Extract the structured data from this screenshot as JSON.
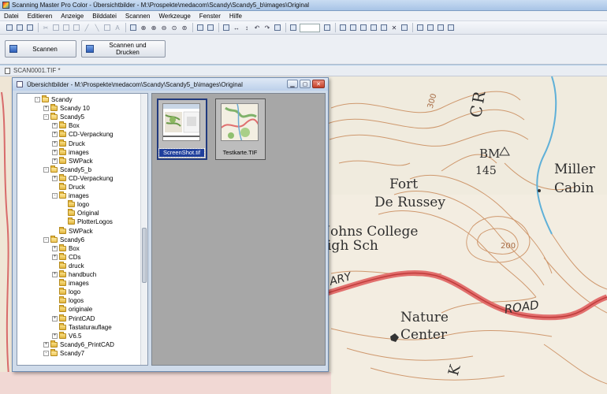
{
  "window": {
    "title": "Scanning Master Pro Color - Übersichtbilder - M:\\Prospekte\\medacom\\Scandy\\Scandy5_b\\images\\Original"
  },
  "menu": [
    "Datei",
    "Editieren",
    "Anzeige",
    "Bilddatei",
    "Scannen",
    "Werkzeuge",
    "Fenster",
    "Hilfe"
  ],
  "buttons": {
    "scan": "Scannen",
    "scan_print": "Scannen und Drucken"
  },
  "document_tab": {
    "label": "SCAN0001.TIF *"
  },
  "child_window": {
    "title": "Übersichtbilder - M:\\Prospekte\\medacom\\Scandy\\Scandy5_b\\images\\Original",
    "buttons": {
      "minimize": "▁",
      "maximize": "▢",
      "close": "✕"
    }
  },
  "tree": [
    {
      "label": "Scandy",
      "level": 0,
      "exp": "-"
    },
    {
      "label": "Scandy 10",
      "level": 1,
      "exp": "+"
    },
    {
      "label": "Scandy5",
      "level": 1,
      "exp": "-"
    },
    {
      "label": "Box",
      "level": 2,
      "exp": "+"
    },
    {
      "label": "CD-Verpackung",
      "level": 2,
      "exp": "+"
    },
    {
      "label": "Druck",
      "level": 2,
      "exp": "+"
    },
    {
      "label": "images",
      "level": 2,
      "exp": "+"
    },
    {
      "label": "SWPack",
      "level": 2,
      "exp": "+"
    },
    {
      "label": "Scandy5_b",
      "level": 1,
      "exp": "-"
    },
    {
      "label": "CD-Verpackung",
      "level": 2,
      "exp": "+"
    },
    {
      "label": "Druck",
      "level": 2,
      "exp": ""
    },
    {
      "label": "images",
      "level": 2,
      "exp": "-"
    },
    {
      "label": "logo",
      "level": 3,
      "exp": ""
    },
    {
      "label": "Original",
      "level": 3,
      "exp": ""
    },
    {
      "label": "PlotterLogos",
      "level": 3,
      "exp": ""
    },
    {
      "label": "SWPack",
      "level": 2,
      "exp": ""
    },
    {
      "label": "Scandy6",
      "level": 1,
      "exp": "-"
    },
    {
      "label": "Box",
      "level": 2,
      "exp": "+"
    },
    {
      "label": "CDs",
      "level": 2,
      "exp": "+"
    },
    {
      "label": "druck",
      "level": 2,
      "exp": ""
    },
    {
      "label": "handbuch",
      "level": 2,
      "exp": "+"
    },
    {
      "label": "images",
      "level": 2,
      "exp": ""
    },
    {
      "label": "logo",
      "level": 2,
      "exp": ""
    },
    {
      "label": "logos",
      "level": 2,
      "exp": ""
    },
    {
      "label": "originale",
      "level": 2,
      "exp": ""
    },
    {
      "label": "PrintCAD",
      "level": 2,
      "exp": "+"
    },
    {
      "label": "Tastaturauflage",
      "level": 2,
      "exp": ""
    },
    {
      "label": "V6.5",
      "level": 2,
      "exp": "+"
    },
    {
      "label": "Scandy6_PrintCAD",
      "level": 1,
      "exp": "+"
    },
    {
      "label": "Scandy7",
      "level": 1,
      "exp": "-"
    }
  ],
  "thumbnails": [
    {
      "caption": "ScreenShot.tif",
      "selected": true
    },
    {
      "caption": "Testkarte.TIF",
      "selected": false
    }
  ],
  "map_labels": {
    "fort": "Fort",
    "de_russey": "De Russey",
    "johns_college": "t Johns College",
    "high_sch": "igh Sch",
    "bm": "BM",
    "bm_num": "145",
    "miller": "Miller",
    "cabin": "Cabin",
    "road": "ROAD",
    "nature": "Nature",
    "center": "Center",
    "ary": "ARY",
    "cr": "CR",
    "contour_300": "300",
    "contour_200": "200",
    "ck": "K"
  }
}
